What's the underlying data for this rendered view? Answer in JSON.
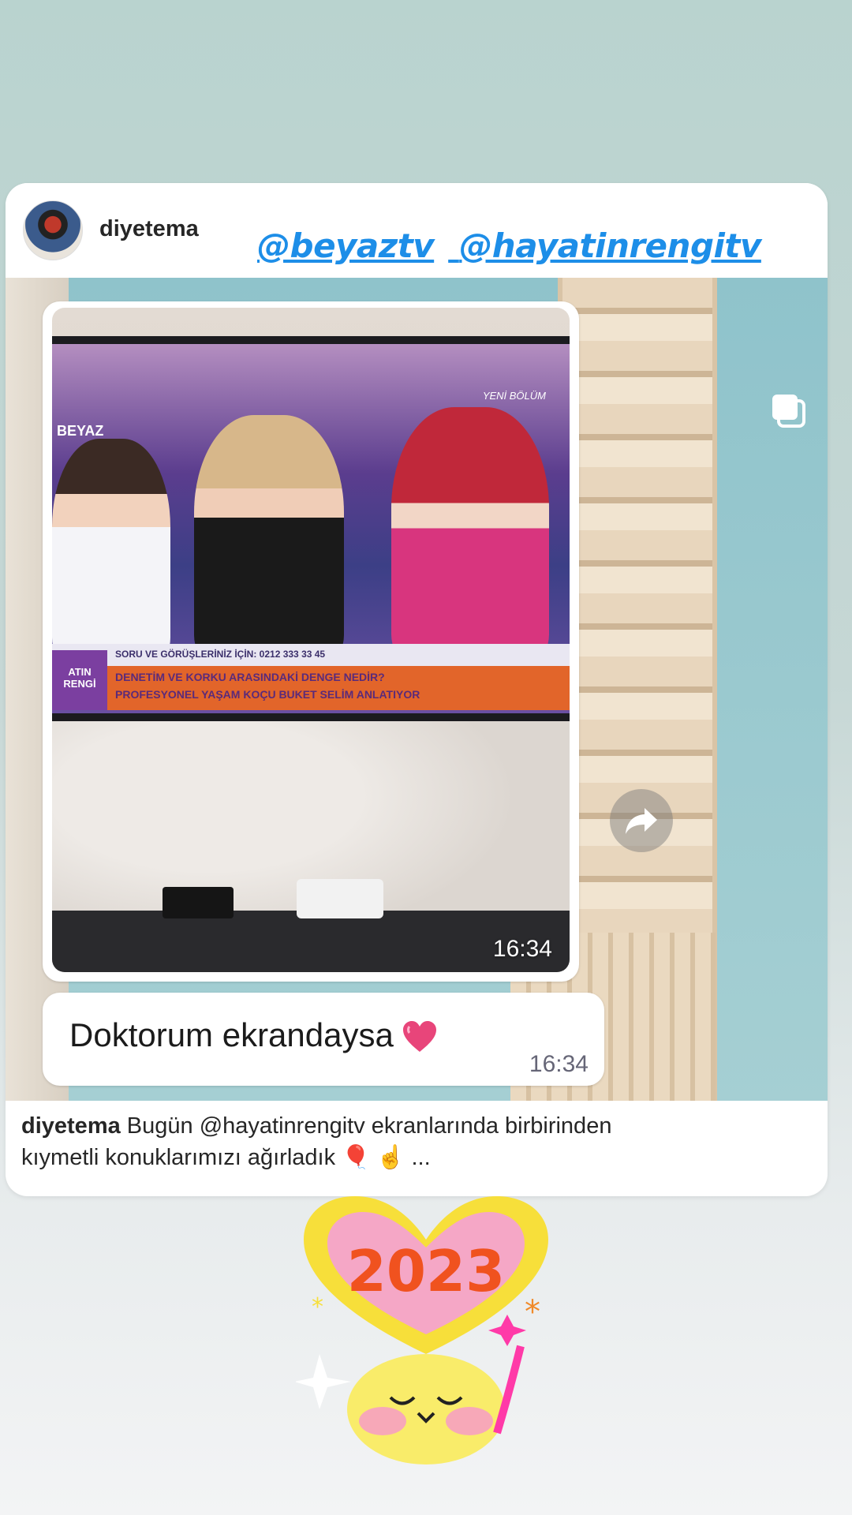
{
  "post": {
    "username": "diyetema",
    "mentions": [
      "@beyaztv",
      "@hayatinrengitv"
    ],
    "photo_timestamp": "16:34",
    "message_text": "Doktorum ekrandaysa",
    "message_timestamp": "16:34",
    "caption_user": "diyetema",
    "caption_line1": "Bugün @hayatinrengitv ekranlarında birbirinden",
    "caption_line2": "kıymetli konuklarımızı ağırladık 🎈 ☝️ ..."
  },
  "tv_overlay": {
    "channel": "BEYAZ",
    "badge": "YENİ BÖLÜM",
    "phone_line": "SORU VE GÖRÜŞLERİNİZ İÇİN: 0212 333 33 45",
    "headline1": "DENETİM VE KORKU ARASINDAKİ DENGE NEDİR?",
    "headline2": "PROFESYONEL YAŞAM KOÇU BUKET SELİM ANLATIYOR",
    "program": "ATIN RENGİ"
  },
  "sticker": {
    "year": "2023"
  },
  "colors": {
    "mention": "#1d8ee8",
    "ticker": "#e2652a",
    "heart": "#e8457a"
  },
  "icons": {
    "forward": "forward-arrow-icon",
    "multi": "carousel-multiple-icon",
    "heart": "sparkling-heart-icon"
  }
}
